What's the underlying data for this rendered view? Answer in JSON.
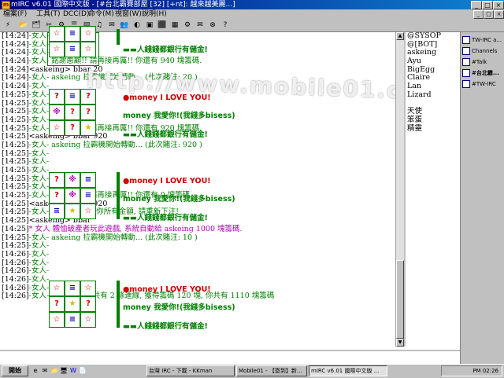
{
  "titlebar": {
    "title": "mIRC v6.01 國際中文版 - [#台北霸賽部屋 [32] [+nt]: 越來越美麗...]",
    "min": "_",
    "max": "□",
    "close": "×"
  },
  "menubar": {
    "items": [
      "檔案(F)",
      "工具(T)",
      "DCC(D)",
      "命令(M)",
      "視窗(W)",
      "說明(H)"
    ],
    "ctl_min": "_",
    "ctl_max": "□",
    "ctl_close": "×"
  },
  "toolbar": {
    "icons": [
      "⚡",
      "📂",
      "🗂",
      "✂",
      "⚙",
      "☰",
      "▤",
      "♫",
      "✉",
      "👥",
      "◐",
      "▣",
      "⬛",
      "▦",
      "⚙",
      "✉",
      "⊗",
      "?"
    ]
  },
  "chat": {
    "lines": [
      {
        "ts": "[14:24]",
        "text": "-女人-",
        "cls": "green"
      },
      {
        "ts": "[14:24]",
        "text": "-女人-",
        "cls": "green"
      },
      {
        "ts": "[14:24]",
        "text": "-女人-",
        "cls": "green"
      },
      {
        "ts": "[14:24]",
        "text": "-女人- 銘謝惠顧!! 請再接再厲!! 你還有 940 塊籌碼.",
        "cls": "green"
      },
      {
        "ts": "[14:24]",
        "text": "<askeing> bbar 20",
        "cls": ""
      },
      {
        "ts": "[14:24]",
        "text": "-女人- askeing 拉霸機開始轉動... (此次賭注: 20 )",
        "cls": "green"
      },
      {
        "ts": "[14:24]",
        "text": "-女人-",
        "cls": "green"
      },
      {
        "ts": "[14:25]",
        "text": "-女人-",
        "cls": "green"
      },
      {
        "ts": "[14:25]",
        "text": "-女人-",
        "cls": "green"
      },
      {
        "ts": "[14:25]",
        "text": "-女人-",
        "cls": "green"
      },
      {
        "ts": "[14:25]",
        "text": "-女人-",
        "cls": "green"
      },
      {
        "ts": "[14:25]",
        "text": "-女人- 銘謝惠顧!! 請再接再厲!! 你還有 920 塊籌碼.",
        "cls": "green"
      },
      {
        "ts": "[14:25]",
        "text": "<askeing> bbar 920",
        "cls": ""
      },
      {
        "ts": "[14:25]",
        "text": "-女人- askeing 拉霸機開始轉動... (此次賭注: 920 )",
        "cls": "green"
      },
      {
        "ts": "[14:25]",
        "text": "-女人-",
        "cls": "green"
      },
      {
        "ts": "[14:25]",
        "text": "-女人-",
        "cls": "green"
      },
      {
        "ts": "[14:25]",
        "text": "-女人-",
        "cls": "green"
      },
      {
        "ts": "[14:25]",
        "text": "-女人-",
        "cls": "green"
      },
      {
        "ts": "[14:25]",
        "text": "-女人-",
        "cls": "green"
      },
      {
        "ts": "[14:25]",
        "text": "-女人- 銘謝惠顧!! 請再接再厲!! 你還有 0 塊籌碼.",
        "cls": "green"
      },
      {
        "ts": "[14:25]",
        "text": "<askeing> bbar 920",
        "cls": ""
      },
      {
        "ts": "[14:25]",
        "text": "-女人- 此次賭注高出你所有金額, 請重新下注!",
        "cls": "green"
      },
      {
        "ts": "[14:25]",
        "text": "<askeing> bbar",
        "cls": ""
      },
      {
        "ts": "[14:25]",
        "text": "* 女人 體恤破產者玩此遊戲, 系統自動給 askeing 1000 塊籌碼.",
        "cls": "magenta"
      },
      {
        "ts": "[14:25]",
        "text": "-女人- askeing 拉霸機開始轉動... (此次賭注: 10 )",
        "cls": "green"
      },
      {
        "ts": "[14:25]",
        "text": "-女人-",
        "cls": "green"
      },
      {
        "ts": "[14:26]",
        "text": "-女人-",
        "cls": "green"
      },
      {
        "ts": "[14:26]",
        "text": "-女人-",
        "cls": "green"
      },
      {
        "ts": "[14:26]",
        "text": "-女人-",
        "cls": "green"
      },
      {
        "ts": "[14:26]",
        "text": "-女人-",
        "cls": "green"
      },
      {
        "ts": "[14:26]",
        "text": "-女人-",
        "cls": "green"
      },
      {
        "ts": "[14:26]",
        "text": "-女人- 連線成功!!! 共有 2 條連線, 獲得籌碼 120 塊, 你共有 1110 塊籌碼",
        "cls": "green"
      }
    ],
    "slot_msgs": {
      "love": "●money I LOVE YOU!",
      "god": "money 我愛你!(我錢多bisess)",
      "bank": "▬▬人錢錢都銀行有儲金!"
    },
    "slot1": [
      "☆",
      "≡",
      "☆",
      "?",
      "※",
      "?",
      "☆",
      "?",
      "★"
    ],
    "slot2": [
      "?",
      "※",
      "≡",
      "?",
      "※",
      "≡",
      "≡",
      "★",
      "☆"
    ],
    "slot3": [
      "☆",
      "≡",
      "☆",
      "?",
      "★",
      "?",
      "☆",
      "≡",
      "☆"
    ]
  },
  "watermark": "http://www.mobile01.com/",
  "nicklist": [
    "@SYSOP",
    "@[BOT]",
    "askeing",
    "Ayu",
    "BigEgg",
    "Claire",
    "Lan",
    "Lizard",
    "",
    "天使",
    "笨蛋",
    "精靈"
  ],
  "switchbar": [
    "TW-IRC a...",
    "Channels",
    "#Talk",
    "#台北霸...",
    "#TW-IRC"
  ],
  "taskbar": {
    "start": "開始",
    "quicklaunch": [
      "e",
      "✉",
      "📁",
      "🖥",
      "W",
      "📄"
    ],
    "tasks": [
      "台灣 IRC - 下載 - KKman",
      "Mobile01 - 【簽到】新...",
      "mIRC v6.01 國際中文版 ..."
    ],
    "clock": "PM 02:26"
  }
}
